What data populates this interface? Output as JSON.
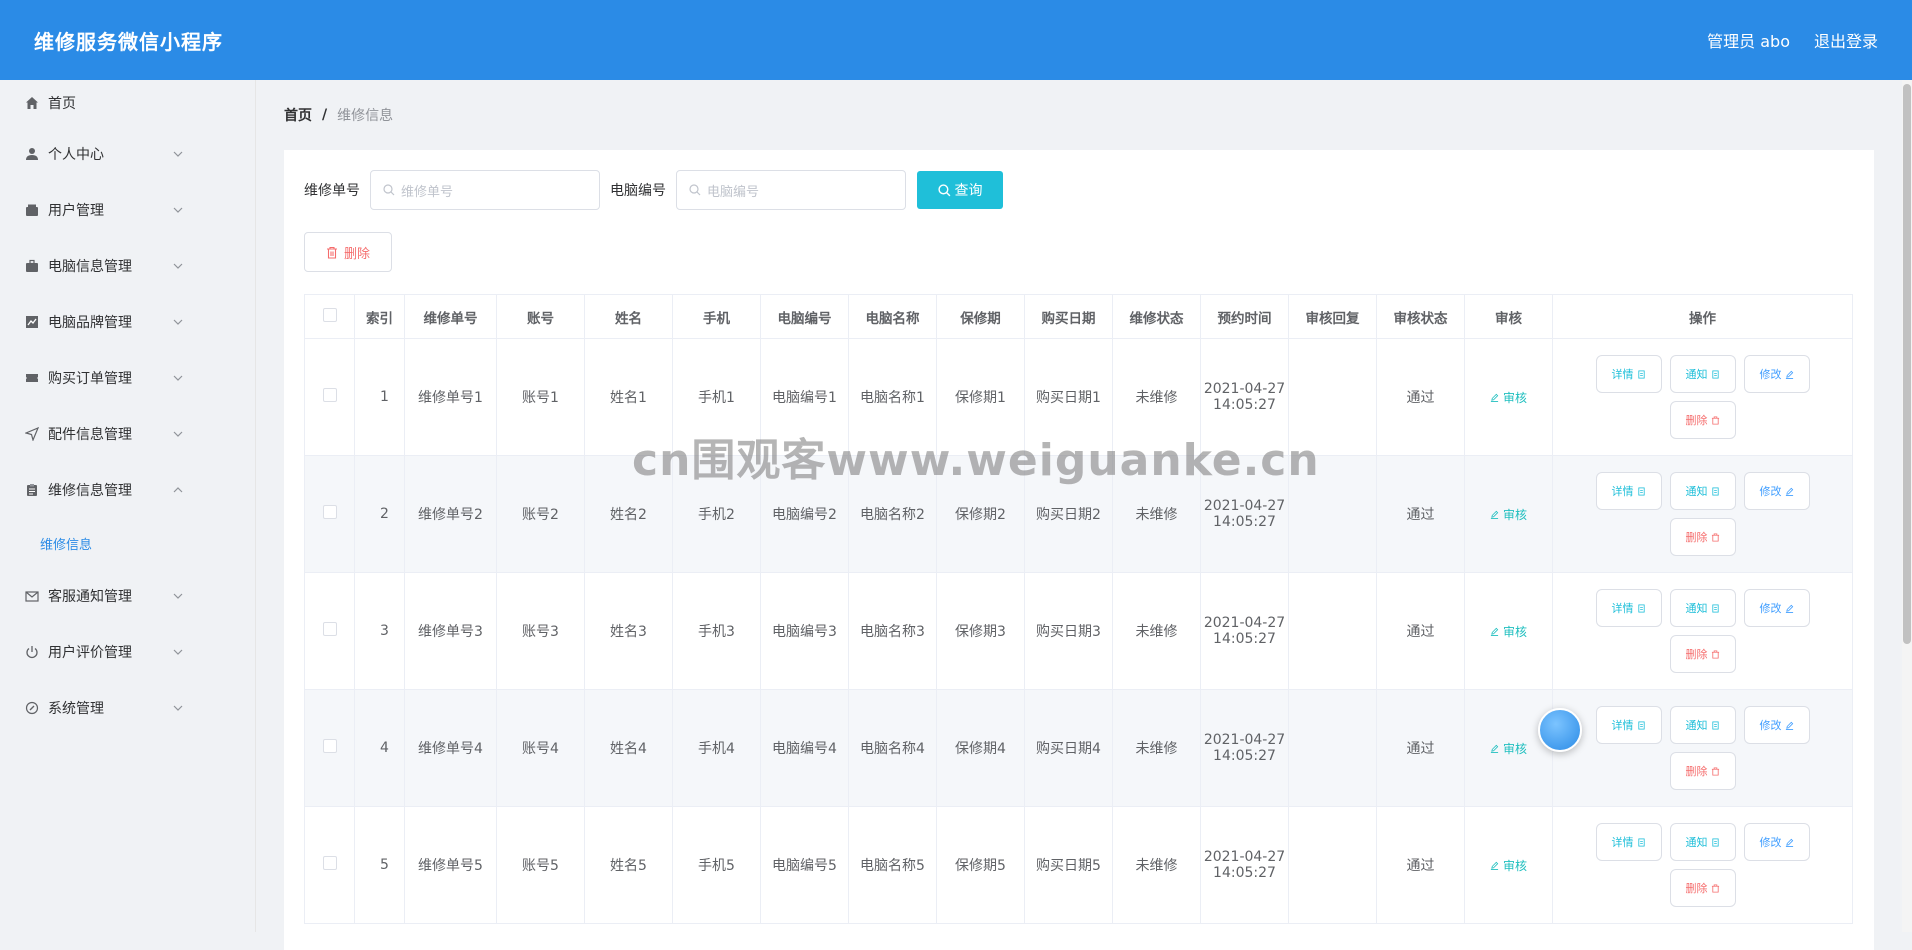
{
  "header": {
    "title": "维修服务微信小程序",
    "admin": "管理员 abo",
    "logout": "退出登录"
  },
  "sidebar": {
    "items": [
      {
        "label": "首页",
        "icon": "home-icon"
      },
      {
        "label": "个人中心",
        "icon": "user-icon"
      },
      {
        "label": "用户管理",
        "icon": "wallet-icon"
      },
      {
        "label": "电脑信息管理",
        "icon": "briefcase-icon"
      },
      {
        "label": "电脑品牌管理",
        "icon": "chart-icon"
      },
      {
        "label": "购买订单管理",
        "icon": "ticket-icon"
      },
      {
        "label": "配件信息管理",
        "icon": "send-icon"
      },
      {
        "label": "维修信息管理",
        "icon": "clipboard-icon"
      },
      {
        "label": "客服通知管理",
        "icon": "mail-icon"
      },
      {
        "label": "用户评价管理",
        "icon": "power-icon"
      },
      {
        "label": "系统管理",
        "icon": "compass-icon"
      }
    ],
    "submenu": {
      "label": "维修信息"
    }
  },
  "breadcrumb": {
    "home": "首页",
    "separator": "/",
    "current": "维修信息"
  },
  "search": {
    "label1": "维修单号",
    "placeholder1": "维修单号",
    "label2": "电脑编号",
    "placeholder2": "电脑编号",
    "query": "查询"
  },
  "toolbar": {
    "delete": "删除"
  },
  "table": {
    "headers": [
      "索引",
      "维修单号",
      "账号",
      "姓名",
      "手机",
      "电脑编号",
      "电脑名称",
      "保修期",
      "购买日期",
      "维修状态",
      "预约时间",
      "审核回复",
      "审核状态",
      "审核",
      "操作"
    ],
    "rows": [
      {
        "index": "1",
        "order": "维修单号1",
        "account": "账号1",
        "name": "姓名1",
        "phone": "手机1",
        "pc_no": "电脑编号1",
        "pc_name": "电脑名称1",
        "warranty": "保修期1",
        "buy_date": "购买日期1",
        "status": "未维修",
        "time": "2021-04-27 14:05:27",
        "reply": "",
        "audit_status": "通过"
      },
      {
        "index": "2",
        "order": "维修单号2",
        "account": "账号2",
        "name": "姓名2",
        "phone": "手机2",
        "pc_no": "电脑编号2",
        "pc_name": "电脑名称2",
        "warranty": "保修期2",
        "buy_date": "购买日期2",
        "status": "未维修",
        "time": "2021-04-27 14:05:27",
        "reply": "",
        "audit_status": "通过"
      },
      {
        "index": "3",
        "order": "维修单号3",
        "account": "账号3",
        "name": "姓名3",
        "phone": "手机3",
        "pc_no": "电脑编号3",
        "pc_name": "电脑名称3",
        "warranty": "保修期3",
        "buy_date": "购买日期3",
        "status": "未维修",
        "time": "2021-04-27 14:05:27",
        "reply": "",
        "audit_status": "通过"
      },
      {
        "index": "4",
        "order": "维修单号4",
        "account": "账号4",
        "name": "姓名4",
        "phone": "手机4",
        "pc_no": "电脑编号4",
        "pc_name": "电脑名称4",
        "warranty": "保修期4",
        "buy_date": "购买日期4",
        "status": "未维修",
        "time": "2021-04-27 14:05:27",
        "reply": "",
        "audit_status": "通过"
      },
      {
        "index": "5",
        "order": "维修单号5",
        "account": "账号5",
        "name": "姓名5",
        "phone": "手机5",
        "pc_no": "电脑编号5",
        "pc_name": "电脑名称5",
        "warranty": "保修期5",
        "buy_date": "购买日期5",
        "status": "未维修",
        "time": "2021-04-27 14:05:27",
        "reply": "",
        "audit_status": "通过"
      }
    ],
    "audit_link": "审核",
    "ops": {
      "detail": "详情",
      "notify": "通知",
      "edit": "修改",
      "delete": "删除"
    }
  },
  "watermark": "cn围观客www.weiguanke.cn",
  "colors": {
    "header_bg": "#2b8be6",
    "accent_cyan": "#1fbfd9",
    "danger": "#f56c6c"
  }
}
